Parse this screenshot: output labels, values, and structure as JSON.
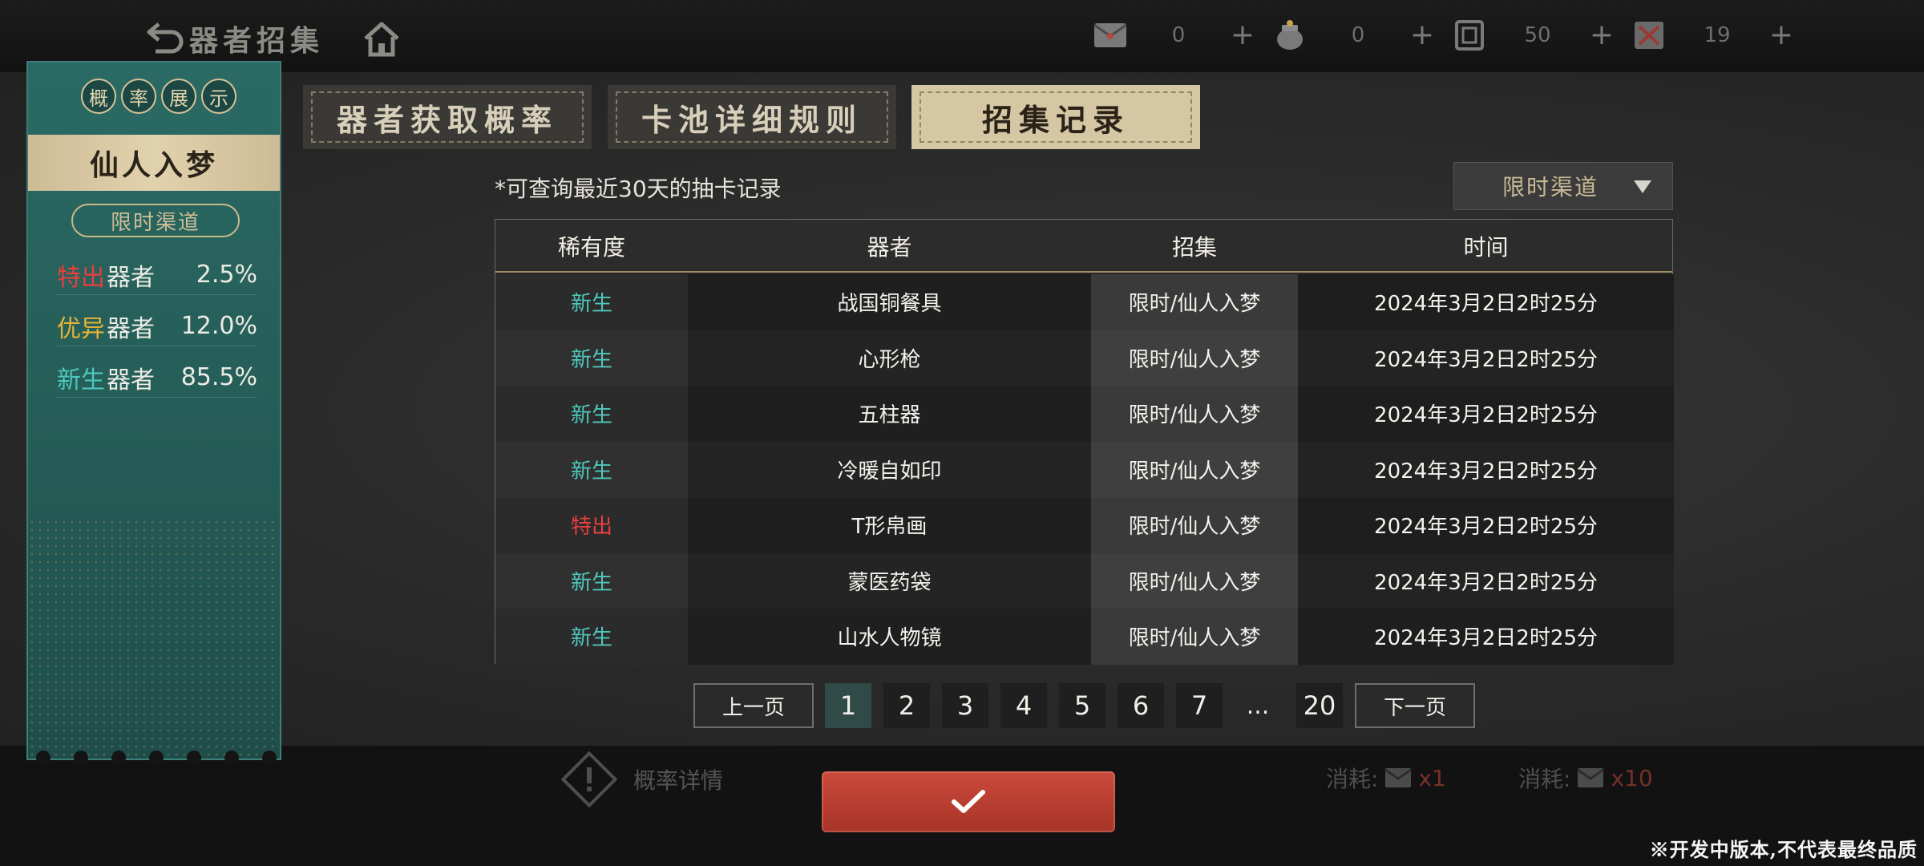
{
  "header": {
    "title": "器者招集",
    "currencies": [
      {
        "icon": "red-envelope-icon",
        "value": "0"
      },
      {
        "icon": "treasure-pot-icon",
        "value": "0"
      },
      {
        "icon": "scroll-ticket-icon",
        "value": "50"
      },
      {
        "icon": "red-card-icon",
        "value": "19"
      }
    ],
    "plus": "+"
  },
  "left_panel": {
    "title_chars": [
      "概",
      "率",
      "展",
      "示"
    ],
    "banner": "仙人入梦",
    "channel": "限时渠道",
    "rates": [
      {
        "type": "特出",
        "kind": "器者",
        "pct": "2.5%",
        "color": "#e83f3f"
      },
      {
        "type": "优异",
        "kind": "器者",
        "pct": "12.0%",
        "color": "#e5b338"
      },
      {
        "type": "新生",
        "kind": "器者",
        "pct": "85.5%",
        "color": "#4fc7bd"
      }
    ]
  },
  "tabs": [
    {
      "label": "器者获取概率",
      "active": false
    },
    {
      "label": "卡池详细规则",
      "active": false
    },
    {
      "label": "招集记录",
      "active": true
    }
  ],
  "records": {
    "note": "*可查询最近30天的抽卡记录",
    "filter_label": "限时渠道",
    "columns": [
      "稀有度",
      "器者",
      "招集",
      "时间"
    ],
    "rows": [
      {
        "rarity": "新生",
        "rarity_color": "green",
        "item": "战国铜餐具",
        "pool": "限时/仙人入梦",
        "time": "2024年3月2日2时25分"
      },
      {
        "rarity": "新生",
        "rarity_color": "green",
        "item": "心形枪",
        "pool": "限时/仙人入梦",
        "time": "2024年3月2日2时25分"
      },
      {
        "rarity": "新生",
        "rarity_color": "green",
        "item": "五柱器",
        "pool": "限时/仙人入梦",
        "time": "2024年3月2日2时25分"
      },
      {
        "rarity": "新生",
        "rarity_color": "green",
        "item": "冷暖自如印",
        "pool": "限时/仙人入梦",
        "time": "2024年3月2日2时25分"
      },
      {
        "rarity": "特出",
        "rarity_color": "red",
        "item": "T形帛画",
        "pool": "限时/仙人入梦",
        "time": "2024年3月2日2时25分"
      },
      {
        "rarity": "新生",
        "rarity_color": "green",
        "item": "蒙医药袋",
        "pool": "限时/仙人入梦",
        "time": "2024年3月2日2时25分"
      },
      {
        "rarity": "新生",
        "rarity_color": "green",
        "item": "山水人物镜",
        "pool": "限时/仙人入梦",
        "time": "2024年3月2日2时25分"
      }
    ]
  },
  "pagination": {
    "prev": "上一页",
    "next": "下一页",
    "pages": [
      "1",
      "2",
      "3",
      "4",
      "5",
      "6",
      "7"
    ],
    "ellipsis": "...",
    "last": "20",
    "current": "1"
  },
  "bottom": {
    "prob_detail": "概率详情",
    "cost_label": "消耗:",
    "cost_1": "x1",
    "cost_10": "x10"
  },
  "footer_note": "※开发中版本,不代表最终品质"
}
